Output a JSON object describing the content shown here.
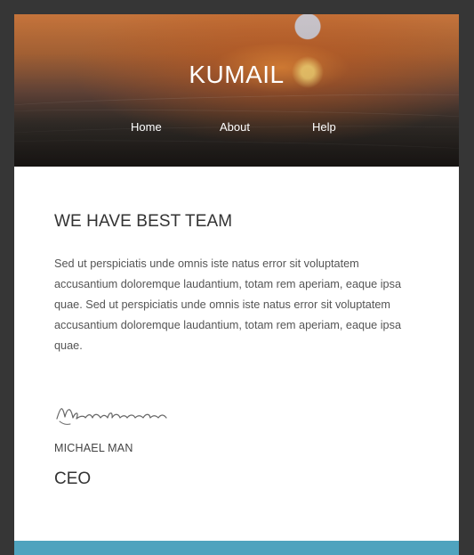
{
  "header": {
    "brand": "KUMAIL",
    "nav": [
      {
        "label": "Home"
      },
      {
        "label": "About"
      },
      {
        "label": "Help"
      }
    ]
  },
  "main": {
    "title": "WE HAVE BEST TEAM",
    "paragraph": "Sed ut perspiciatis unde omnis iste natus error sit voluptatem accusantium doloremque laudantium, totam rem aperiam, eaque ipsa quae. Sed ut perspiciatis unde omnis iste natus error sit voluptatem accusantium doloremque laudantium, totam rem aperiam, eaque ipsa quae.",
    "signature_text": "Michael man",
    "name": "MICHAEL MAN",
    "role": "CEO"
  },
  "colors": {
    "background": "#363636",
    "accent": "#4fa3be",
    "text": "#333333"
  }
}
